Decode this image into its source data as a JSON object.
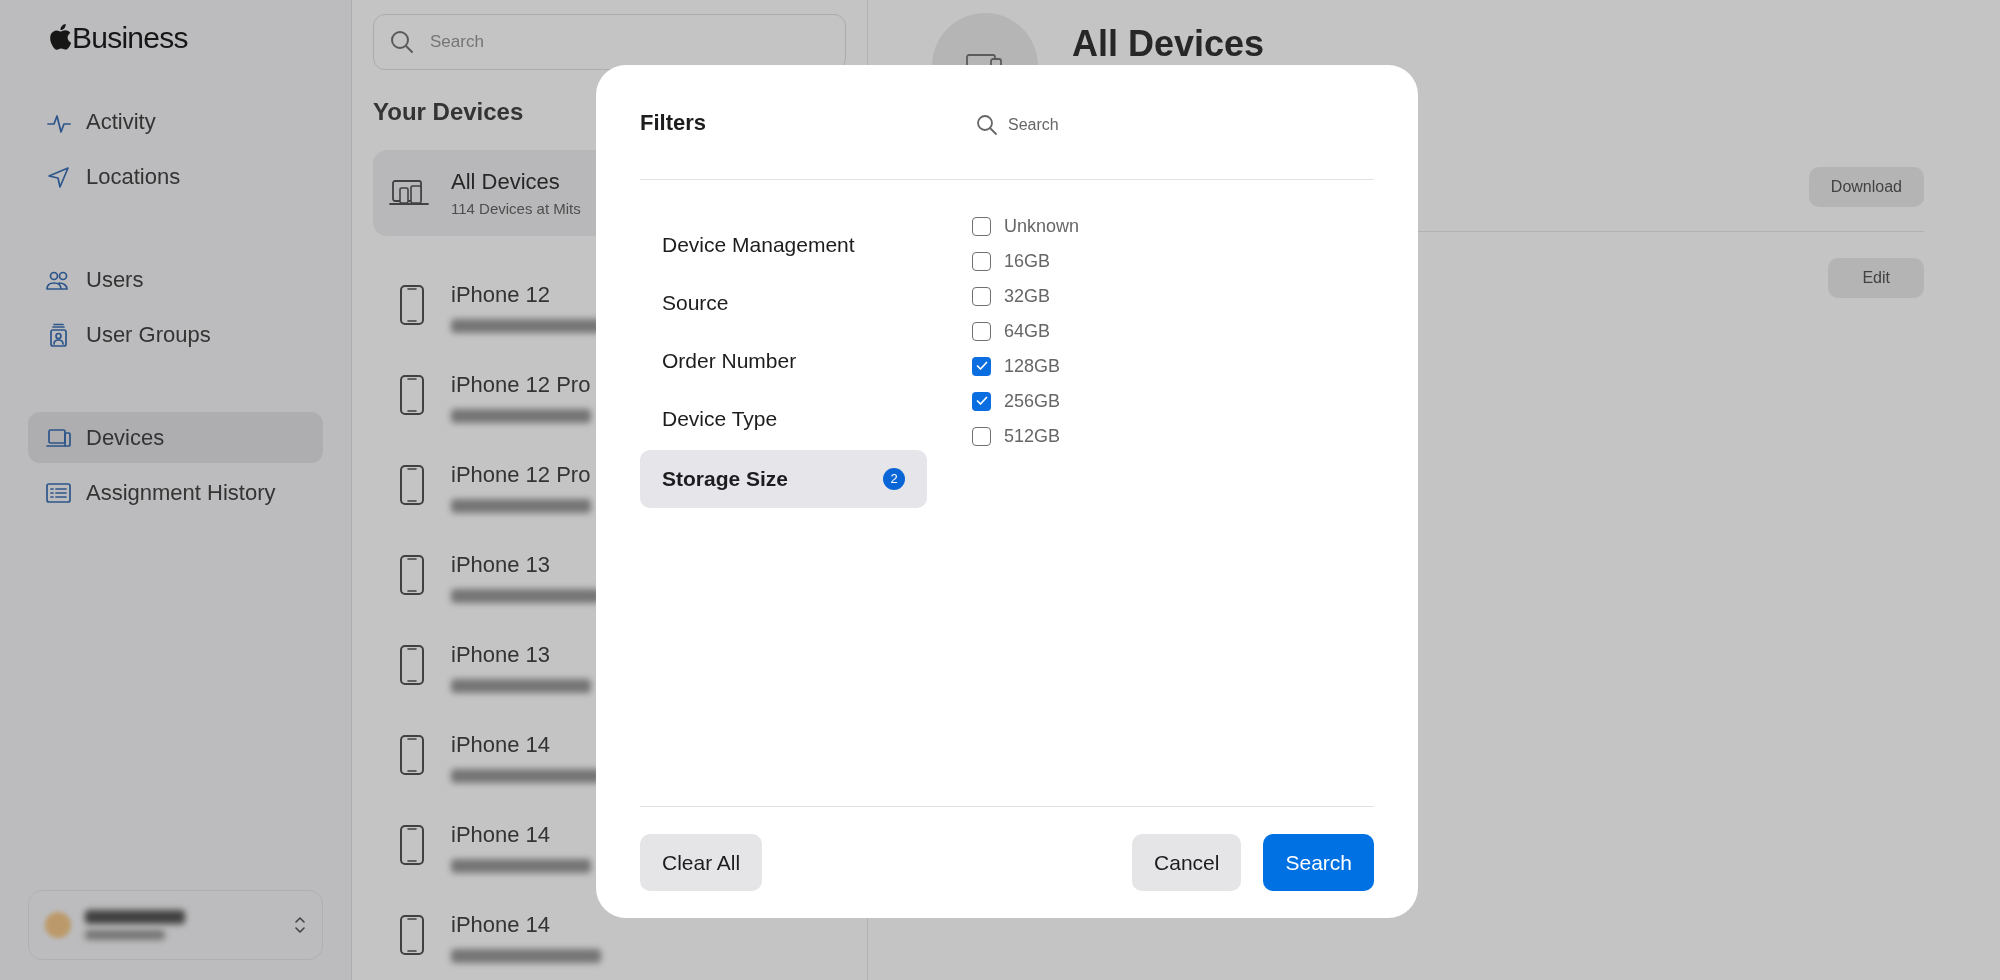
{
  "sidebar": {
    "logo": "Business",
    "sections": [
      [
        {
          "label": "Activity",
          "kind": "activity",
          "selected": false
        },
        {
          "label": "Locations",
          "kind": "location",
          "selected": false
        }
      ],
      [
        {
          "label": "Users",
          "kind": "users",
          "selected": false
        },
        {
          "label": "User Groups",
          "kind": "groups",
          "selected": false
        }
      ],
      [
        {
          "label": "Devices",
          "kind": "devices",
          "selected": true
        },
        {
          "label": "Assignment History",
          "kind": "history",
          "selected": false
        }
      ]
    ]
  },
  "device_list": {
    "search": {
      "placeholder": "Search"
    },
    "title": "Your Devices",
    "all_devices": {
      "title": "All Devices",
      "subtitle": "114 Devices at Mits"
    },
    "devices": [
      {
        "name": "iPhone 12"
      },
      {
        "name": "iPhone 12 Pro"
      },
      {
        "name": "iPhone 12 Pro"
      },
      {
        "name": "iPhone 13"
      },
      {
        "name": "iPhone 13"
      },
      {
        "name": "iPhone 14"
      },
      {
        "name": "iPhone 14"
      },
      {
        "name": "iPhone 14"
      }
    ]
  },
  "detail": {
    "title": "All Devices",
    "buttons": [
      "Download",
      "Edit"
    ]
  },
  "filters": {
    "title": "Filters",
    "search": {
      "placeholder": "Search"
    },
    "categories": [
      {
        "label": "Device Management",
        "selected": false
      },
      {
        "label": "Source",
        "selected": false
      },
      {
        "label": "Order Number",
        "selected": false
      },
      {
        "label": "Device Type",
        "selected": false
      },
      {
        "label": "Storage Size",
        "selected": true,
        "badge": "2"
      }
    ],
    "options": [
      {
        "label": "Unknown",
        "checked": false
      },
      {
        "label": "16GB",
        "checked": false
      },
      {
        "label": "32GB",
        "checked": false
      },
      {
        "label": "64GB",
        "checked": false
      },
      {
        "label": "128GB",
        "checked": true
      },
      {
        "label": "256GB",
        "checked": true
      },
      {
        "label": "512GB",
        "checked": false
      }
    ],
    "buttons": [
      {
        "label": "Clear All",
        "kind": "secondary"
      },
      {
        "label": "Cancel",
        "kind": "secondary"
      },
      {
        "label": "Search",
        "kind": "primary"
      }
    ]
  }
}
